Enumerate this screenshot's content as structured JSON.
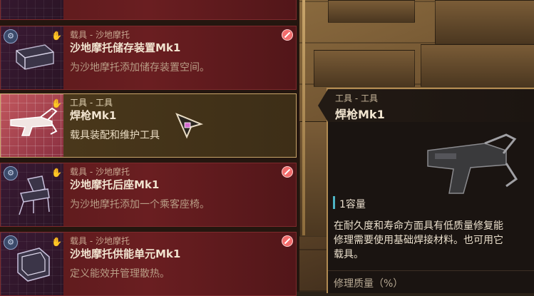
{
  "items": [
    {
      "category": "",
      "title": "",
      "description": "",
      "state": "forbidden"
    },
    {
      "category": "载具 - 沙地摩托",
      "title": "沙地摩托储存装置Mk1",
      "description": "为沙地摩托添加储存装置空间。",
      "state": "forbidden"
    },
    {
      "category": "工具 - 工具",
      "title": "焊枪Mk1",
      "description": "载具装配和维护工具",
      "state": "selected"
    },
    {
      "category": "载具 - 沙地摩托",
      "title": "沙地摩托后座Mk1",
      "description": "为沙地摩托添加一个乘客座椅。",
      "state": "forbidden"
    },
    {
      "category": "载具 - 沙地摩托",
      "title": "沙地摩托供能单元Mk1",
      "description": "定义能效并管理散热。",
      "state": "forbidden"
    }
  ],
  "tooltip": {
    "category": "工具 - 工具",
    "title": "焊枪Mk1",
    "capacity": "1容量",
    "description": "在耐久度和寿命方面具有低质量修复能\n修理需要使用基础焊接材料。也可用它\n载具。",
    "quality_label": "修理质量（%）"
  },
  "colors": {
    "forbidden_card": "#6a1e21",
    "selected_border": "#c9a56a",
    "accent_gold": "#b08a52",
    "capacity_bar": "#4db3c4"
  }
}
